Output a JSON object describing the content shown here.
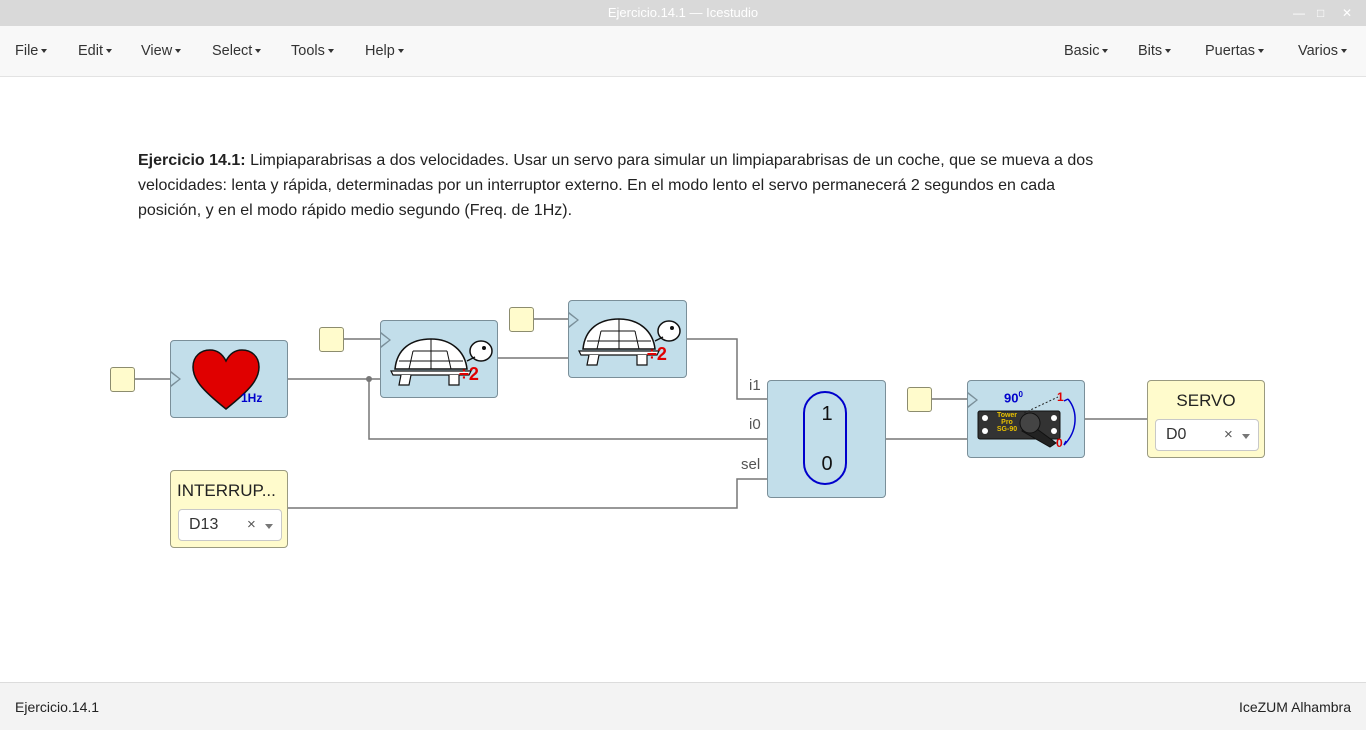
{
  "window": {
    "title": "Ejercicio.14.1 — Icestudio",
    "controls": [
      "—",
      "□",
      "✕"
    ]
  },
  "menu_left": [
    "File",
    "Edit",
    "View",
    "Select",
    "Tools",
    "Help"
  ],
  "menu_right": [
    "Basic",
    "Bits",
    "Puertas",
    "Varios"
  ],
  "description": {
    "title": "Ejercicio 14.1:",
    "text": " Limpiaparabrisas a dos velocidades. Usar un servo para simular un limpiaparabrisas de un coche, que se mueva a dos velocidades: lenta y rápida, determinadas por un interruptor externo. En el modo lento el servo permanecerá 2 segundos en cada posición, y en el modo rápido medio segundo (Freq. de 1Hz)."
  },
  "blocks": {
    "heartbeat": {
      "icon": "heart-icon",
      "freq_label": "1Hz",
      "color": "#e00000",
      "label_color": "#0000cc"
    },
    "divider1": {
      "icon": "turtle-icon",
      "label": "÷2",
      "label_color": "#e00000"
    },
    "divider2": {
      "icon": "turtle-icon",
      "label": "÷2",
      "label_color": "#e00000"
    },
    "mux": {
      "inputs": [
        "i1",
        "i0",
        "sel"
      ],
      "values": [
        "1",
        "0"
      ],
      "border_color": "#0000cc"
    },
    "servo": {
      "icon": "servo-icon",
      "angle": "90",
      "angle_sup": "0",
      "brand": [
        "Tower",
        "Pro",
        "SG-90"
      ],
      "pos1": "1",
      "pos0": "0"
    },
    "input_switch": {
      "title": "INTERRUP...",
      "pin": "D13",
      "clear": "×"
    },
    "output_servo": {
      "title": "SERVO",
      "pin": "D0",
      "clear": "×"
    }
  },
  "statusbar": {
    "left": "Ejercicio.14.1",
    "right": "IceZUM Alhambra"
  }
}
